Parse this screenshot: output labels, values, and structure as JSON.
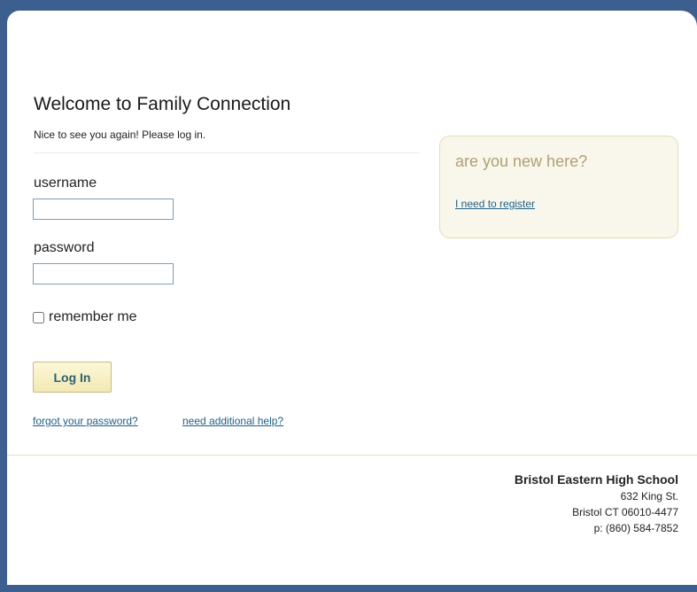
{
  "login": {
    "title": "Welcome to Family Connection",
    "subtitle": "Nice to see you again! Please log in.",
    "username_label": "username",
    "username_value": "",
    "password_label": "password",
    "password_value": "",
    "remember_label": "remember me",
    "remember_checked": false,
    "submit_label": "Log In",
    "forgot_link": "forgot your password?",
    "help_link": "need additional help?"
  },
  "new_user": {
    "heading": "are you new here?",
    "register_link": "I need to register"
  },
  "footer": {
    "school_name": "Bristol Eastern High School",
    "address_line1": "632 King St.",
    "address_line2": "Bristol CT 06010-4477",
    "phone": "p: (860) 584-7852"
  },
  "colors": {
    "background": "#3d5f8f",
    "link": "#1f5f86",
    "button_text": "#2b6170",
    "button_fill": "#fcf7d9",
    "panel_fill": "#f9f7ec",
    "panel_heading": "#b09f73"
  }
}
